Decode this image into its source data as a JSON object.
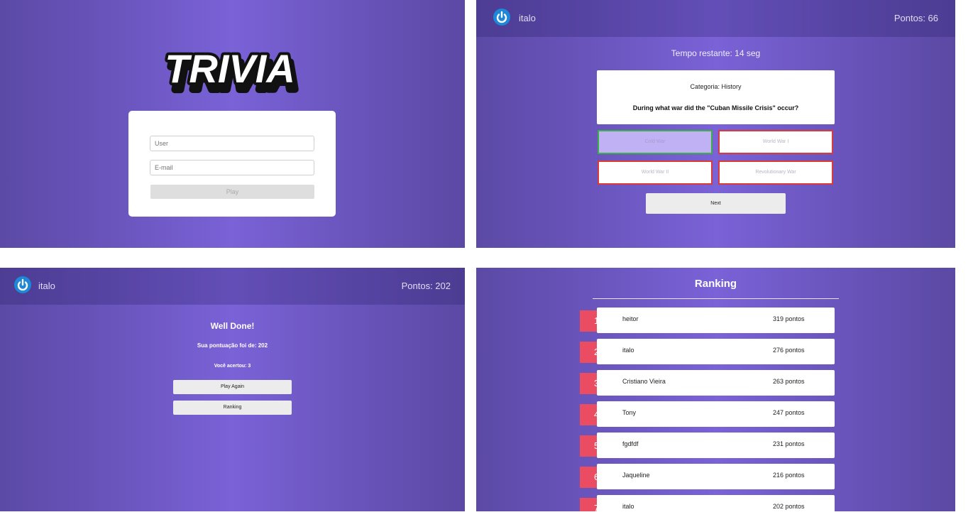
{
  "colors": {
    "panel_gradient": [
      "#5c4aa6",
      "#7a62d7"
    ],
    "correct_border": "#3eae48",
    "wrong_border": "#d93b3b",
    "rank_badge": "#ea4d62",
    "logo_blue": "#1e87d6"
  },
  "login": {
    "logo_text": "TRIVIA",
    "user_placeholder": "User",
    "email_placeholder": "E-mail",
    "play_label": "Play"
  },
  "game": {
    "header": {
      "logo_icon": "power-icon",
      "user": "italo",
      "score": "Pontos: 66"
    },
    "timer": "Tempo restante: 14 seg",
    "category": "Categoria: History",
    "question": "During what war did the \"Cuban Missile Crisis\" occur?",
    "answers": [
      "Cold War",
      "World War I",
      "World War II",
      "Revolutionary War"
    ],
    "next_label": "Next"
  },
  "feedback": {
    "header": {
      "logo_icon": "power-icon",
      "user": "italo",
      "score": "Pontos: 202"
    },
    "title": "Well Done!",
    "score_text": "Sua pontuação foi de: 202",
    "hits_text": "Você acertou: 3",
    "play_again_label": "Play Again",
    "ranking_label": "Ranking"
  },
  "ranking": {
    "title": "Ranking",
    "rows": [
      {
        "rank": "1",
        "name": "heitor",
        "points": "319 pontos"
      },
      {
        "rank": "2",
        "name": "italo",
        "points": "276 pontos"
      },
      {
        "rank": "3",
        "name": "Cristiano Vieira",
        "points": "263 pontos"
      },
      {
        "rank": "4",
        "name": "Tony",
        "points": "247 pontos"
      },
      {
        "rank": "5",
        "name": "fgdfdf",
        "points": "231 pontos"
      },
      {
        "rank": "6",
        "name": "Jaqueline",
        "points": "216 pontos"
      },
      {
        "rank": "7",
        "name": "italo",
        "points": "202 pontos"
      }
    ]
  }
}
